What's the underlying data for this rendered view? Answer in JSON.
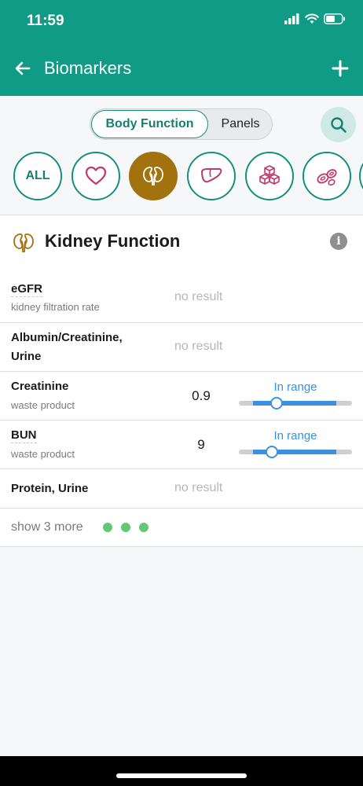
{
  "status": {
    "time": "11:59"
  },
  "header": {
    "title": "Biomarkers"
  },
  "tabs": {
    "body_function": "Body Function",
    "panels": "Panels"
  },
  "filters": {
    "all_label": "ALL",
    "active_color": "#a2720e",
    "chips": [
      "all",
      "heart",
      "kidney",
      "liver",
      "cubes",
      "cells"
    ]
  },
  "section": {
    "title": "Kidney Function"
  },
  "biomarkers": [
    {
      "name": "eGFR",
      "subtitle": "kidney filtration rate",
      "result": "no result"
    },
    {
      "name": "Albumin/Creatinine,",
      "name2": "Urine",
      "result": "no result"
    },
    {
      "name": "Creatinine",
      "subtitle": "waste product",
      "value": "0.9",
      "range_label": "In range"
    },
    {
      "name": "BUN",
      "subtitle": "waste product",
      "value": "9",
      "range_label": "In range"
    },
    {
      "name": "Protein, Urine",
      "result": "no result"
    }
  ],
  "show_more": "show 3 more",
  "colors": {
    "brand": "#109b86",
    "range": "#3a91e0",
    "dots": "#63c775"
  }
}
